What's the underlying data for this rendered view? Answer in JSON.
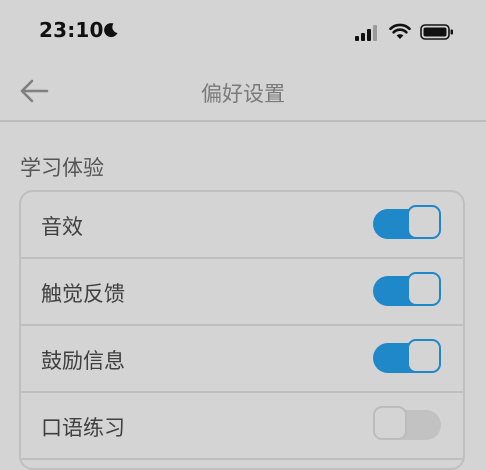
{
  "status_bar": {
    "time": "23:10"
  },
  "nav": {
    "title": "偏好设置"
  },
  "section": {
    "title": "学习体验"
  },
  "settings": [
    {
      "label": "音效",
      "enabled": true
    },
    {
      "label": "触觉反馈",
      "enabled": true
    },
    {
      "label": "鼓励信息",
      "enabled": true
    },
    {
      "label": "口语练习",
      "enabled": false
    }
  ],
  "colors": {
    "background": "#d4d4d4",
    "accent": "#1e88c9",
    "toggle_off": "#c2c2c2",
    "divider": "#bfbfbf"
  },
  "icons": {
    "back": "arrow-left-icon",
    "moon": "moon-icon",
    "signal": "cellular-signal-icon",
    "wifi": "wifi-icon",
    "battery": "battery-icon"
  }
}
